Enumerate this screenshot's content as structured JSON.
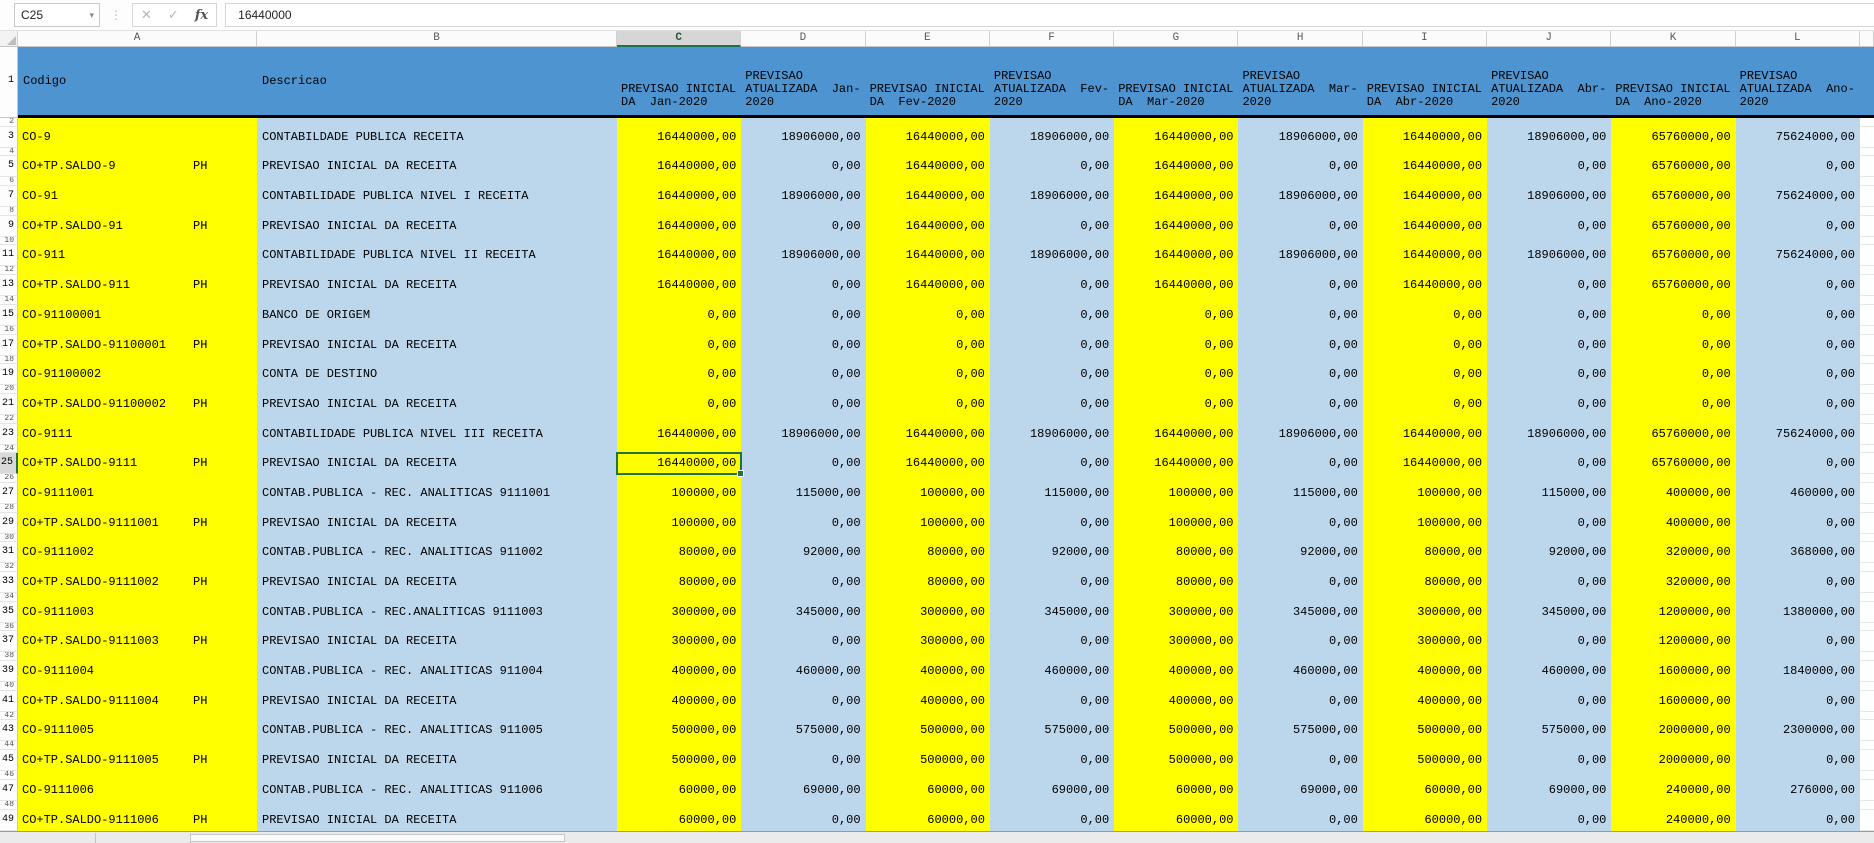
{
  "formula_bar": {
    "name_box": "C25",
    "formula": "16440000"
  },
  "icons": {
    "name_box_caret": "▾",
    "separator_dots": "⋮",
    "cancel": "✕",
    "accept": "✓",
    "function": "fx"
  },
  "colors": {
    "header_blue": "#4D94D0",
    "band_yellow": "#FFFF00",
    "band_blue": "#BCD6EC",
    "selection_green": "#1F7244"
  },
  "sheet": {
    "selected_cell": "C25",
    "selected_row": 25,
    "selected_col": "C",
    "col_letters": [
      "A",
      "B",
      "C",
      "D",
      "E",
      "F",
      "G",
      "H",
      "I",
      "J",
      "K",
      "L"
    ],
    "row1_number": "1",
    "headers": [
      "Codigo",
      "Descricao",
      "PREVISAO INICIAL\nDA  Jan-2020",
      "PREVISAO\nATUALIZADA  Jan-\n2020",
      "PREVISAO INICIAL\nDA  Fev-2020",
      "PREVISAO\nATUALIZADA  Fev-\n2020",
      "PREVISAO INICIAL\nDA  Mar-2020",
      "PREVISAO\nATUALIZADA  Mar-\n2020",
      "PREVISAO INICIAL\nDA  Abr-2020",
      "PREVISAO\nATUALIZADA  Abr-\n2020",
      "PREVISAO INICIAL\nDA  Ano-2020",
      "PREVISAO\nATUALIZADA  Ano-\n2020"
    ],
    "rows": [
      {
        "n": 2,
        "type": "spacer"
      },
      {
        "n": 3,
        "type": "data",
        "code": "CO-9",
        "ph": "",
        "desc": "CONTABILDADE PUBLICA RECEITA",
        "values": [
          "16440000,00",
          "18906000,00",
          "16440000,00",
          "18906000,00",
          "16440000,00",
          "18906000,00",
          "16440000,00",
          "18906000,00",
          "65760000,00",
          "75624000,00"
        ]
      },
      {
        "n": 4,
        "type": "spacer"
      },
      {
        "n": 5,
        "type": "data",
        "code": "CO+TP.SALDO-9",
        "ph": "PH",
        "desc": "PREVISAO INICIAL DA RECEITA",
        "values": [
          "16440000,00",
          "0,00",
          "16440000,00",
          "0,00",
          "16440000,00",
          "0,00",
          "16440000,00",
          "0,00",
          "65760000,00",
          "0,00"
        ]
      },
      {
        "n": 6,
        "type": "spacer"
      },
      {
        "n": 7,
        "type": "data",
        "code": "CO-91",
        "ph": "",
        "desc": "CONTABILIDADE PUBLICA NIVEL I RECEITA",
        "values": [
          "16440000,00",
          "18906000,00",
          "16440000,00",
          "18906000,00",
          "16440000,00",
          "18906000,00",
          "16440000,00",
          "18906000,00",
          "65760000,00",
          "75624000,00"
        ]
      },
      {
        "n": 8,
        "type": "spacer"
      },
      {
        "n": 9,
        "type": "data",
        "code": "CO+TP.SALDO-91",
        "ph": "PH",
        "desc": "PREVISAO INICIAL DA RECEITA",
        "values": [
          "16440000,00",
          "0,00",
          "16440000,00",
          "0,00",
          "16440000,00",
          "0,00",
          "16440000,00",
          "0,00",
          "65760000,00",
          "0,00"
        ]
      },
      {
        "n": 10,
        "type": "spacer"
      },
      {
        "n": 11,
        "type": "data",
        "code": "CO-911",
        "ph": "",
        "desc": "CONTABILIDADE PUBLICA NIVEL II RECEITA",
        "values": [
          "16440000,00",
          "18906000,00",
          "16440000,00",
          "18906000,00",
          "16440000,00",
          "18906000,00",
          "16440000,00",
          "18906000,00",
          "65760000,00",
          "75624000,00"
        ]
      },
      {
        "n": 12,
        "type": "spacer"
      },
      {
        "n": 13,
        "type": "data",
        "code": "CO+TP.SALDO-911",
        "ph": "PH",
        "desc": "PREVISAO INICIAL DA RECEITA",
        "values": [
          "16440000,00",
          "0,00",
          "16440000,00",
          "0,00",
          "16440000,00",
          "0,00",
          "16440000,00",
          "0,00",
          "65760000,00",
          "0,00"
        ]
      },
      {
        "n": 14,
        "type": "spacer"
      },
      {
        "n": 15,
        "type": "data",
        "code": "CO-91100001",
        "ph": "",
        "desc": "BANCO DE ORIGEM",
        "values": [
          "0,00",
          "0,00",
          "0,00",
          "0,00",
          "0,00",
          "0,00",
          "0,00",
          "0,00",
          "0,00",
          "0,00"
        ]
      },
      {
        "n": 16,
        "type": "spacer"
      },
      {
        "n": 17,
        "type": "data",
        "code": "CO+TP.SALDO-91100001",
        "ph": "PH",
        "desc": "PREVISAO INICIAL DA RECEITA",
        "values": [
          "0,00",
          "0,00",
          "0,00",
          "0,00",
          "0,00",
          "0,00",
          "0,00",
          "0,00",
          "0,00",
          "0,00"
        ]
      },
      {
        "n": 18,
        "type": "spacer"
      },
      {
        "n": 19,
        "type": "data",
        "code": "CO-91100002",
        "ph": "",
        "desc": "CONTA DE DESTINO",
        "values": [
          "0,00",
          "0,00",
          "0,00",
          "0,00",
          "0,00",
          "0,00",
          "0,00",
          "0,00",
          "0,00",
          "0,00"
        ]
      },
      {
        "n": 20,
        "type": "spacer"
      },
      {
        "n": 21,
        "type": "data",
        "code": "CO+TP.SALDO-91100002",
        "ph": "PH",
        "desc": "PREVISAO INICIAL DA RECEITA",
        "values": [
          "0,00",
          "0,00",
          "0,00",
          "0,00",
          "0,00",
          "0,00",
          "0,00",
          "0,00",
          "0,00",
          "0,00"
        ]
      },
      {
        "n": 22,
        "type": "spacer"
      },
      {
        "n": 23,
        "type": "data",
        "code": "CO-9111",
        "ph": "",
        "desc": "CONTABILIDADE PUBLICA NIVEL III RECEITA",
        "values": [
          "16440000,00",
          "18906000,00",
          "16440000,00",
          "18906000,00",
          "16440000,00",
          "18906000,00",
          "16440000,00",
          "18906000,00",
          "65760000,00",
          "75624000,00"
        ]
      },
      {
        "n": 24,
        "type": "spacer"
      },
      {
        "n": 25,
        "type": "data",
        "code": "CO+TP.SALDO-9111",
        "ph": "PH",
        "desc": "PREVISAO INICIAL DA RECEITA",
        "values": [
          "16440000,00",
          "0,00",
          "16440000,00",
          "0,00",
          "16440000,00",
          "0,00",
          "16440000,00",
          "0,00",
          "65760000,00",
          "0,00"
        ]
      },
      {
        "n": 26,
        "type": "spacer"
      },
      {
        "n": 27,
        "type": "data",
        "code": "CO-9111001",
        "ph": "",
        "desc": "CONTAB.PUBLICA - REC. ANALITICAS 9111001",
        "values": [
          "100000,00",
          "115000,00",
          "100000,00",
          "115000,00",
          "100000,00",
          "115000,00",
          "100000,00",
          "115000,00",
          "400000,00",
          "460000,00"
        ]
      },
      {
        "n": 28,
        "type": "spacer"
      },
      {
        "n": 29,
        "type": "data",
        "code": "CO+TP.SALDO-9111001",
        "ph": "PH",
        "desc": "PREVISAO INICIAL DA RECEITA",
        "values": [
          "100000,00",
          "0,00",
          "100000,00",
          "0,00",
          "100000,00",
          "0,00",
          "100000,00",
          "0,00",
          "400000,00",
          "0,00"
        ]
      },
      {
        "n": 30,
        "type": "spacer"
      },
      {
        "n": 31,
        "type": "data",
        "code": "CO-9111002",
        "ph": "",
        "desc": "CONTAB.PUBLICA - REC. ANALITICAS 911002",
        "values": [
          "80000,00",
          "92000,00",
          "80000,00",
          "92000,00",
          "80000,00",
          "92000,00",
          "80000,00",
          "92000,00",
          "320000,00",
          "368000,00"
        ]
      },
      {
        "n": 32,
        "type": "spacer"
      },
      {
        "n": 33,
        "type": "data",
        "code": "CO+TP.SALDO-9111002",
        "ph": "PH",
        "desc": "PREVISAO INICIAL DA RECEITA",
        "values": [
          "80000,00",
          "0,00",
          "80000,00",
          "0,00",
          "80000,00",
          "0,00",
          "80000,00",
          "0,00",
          "320000,00",
          "0,00"
        ]
      },
      {
        "n": 34,
        "type": "spacer"
      },
      {
        "n": 35,
        "type": "data",
        "code": "CO-9111003",
        "ph": "",
        "desc": "CONTAB.PUBLICA - REC.ANALITICAS 9111003",
        "values": [
          "300000,00",
          "345000,00",
          "300000,00",
          "345000,00",
          "300000,00",
          "345000,00",
          "300000,00",
          "345000,00",
          "1200000,00",
          "1380000,00"
        ]
      },
      {
        "n": 36,
        "type": "spacer"
      },
      {
        "n": 37,
        "type": "data",
        "code": "CO+TP.SALDO-9111003",
        "ph": "PH",
        "desc": "PREVISAO INICIAL DA RECEITA",
        "values": [
          "300000,00",
          "0,00",
          "300000,00",
          "0,00",
          "300000,00",
          "0,00",
          "300000,00",
          "0,00",
          "1200000,00",
          "0,00"
        ]
      },
      {
        "n": 38,
        "type": "spacer"
      },
      {
        "n": 39,
        "type": "data",
        "code": "CO-9111004",
        "ph": "",
        "desc": "CONTAB.PUBLICA - REC. ANALITICAS 911004",
        "values": [
          "400000,00",
          "460000,00",
          "400000,00",
          "460000,00",
          "400000,00",
          "460000,00",
          "400000,00",
          "460000,00",
          "1600000,00",
          "1840000,00"
        ]
      },
      {
        "n": 40,
        "type": "spacer"
      },
      {
        "n": 41,
        "type": "data",
        "code": "CO+TP.SALDO-9111004",
        "ph": "PH",
        "desc": "PREVISAO INICIAL DA RECEITA",
        "values": [
          "400000,00",
          "0,00",
          "400000,00",
          "0,00",
          "400000,00",
          "0,00",
          "400000,00",
          "0,00",
          "1600000,00",
          "0,00"
        ]
      },
      {
        "n": 42,
        "type": "spacer"
      },
      {
        "n": 43,
        "type": "data",
        "code": "CO-9111005",
        "ph": "",
        "desc": "CONTAB.PUBLICA - REC. ANALITICAS 911005",
        "values": [
          "500000,00",
          "575000,00",
          "500000,00",
          "575000,00",
          "500000,00",
          "575000,00",
          "500000,00",
          "575000,00",
          "2000000,00",
          "2300000,00"
        ]
      },
      {
        "n": 44,
        "type": "spacer"
      },
      {
        "n": 45,
        "type": "data",
        "code": "CO+TP.SALDO-9111005",
        "ph": "PH",
        "desc": "PREVISAO INICIAL DA RECEITA",
        "values": [
          "500000,00",
          "0,00",
          "500000,00",
          "0,00",
          "500000,00",
          "0,00",
          "500000,00",
          "0,00",
          "2000000,00",
          "0,00"
        ]
      },
      {
        "n": 46,
        "type": "spacer"
      },
      {
        "n": 47,
        "type": "data",
        "code": "CO-9111006",
        "ph": "",
        "desc": "CONTAB.PUBLICA - REC. ANALITICAS 911006",
        "values": [
          "60000,00",
          "69000,00",
          "60000,00",
          "69000,00",
          "60000,00",
          "69000,00",
          "60000,00",
          "69000,00",
          "240000,00",
          "276000,00"
        ]
      },
      {
        "n": 48,
        "type": "spacer"
      },
      {
        "n": 49,
        "type": "data",
        "code": "CO+TP.SALDO-9111006",
        "ph": "PH",
        "desc": "PREVISAO INICIAL DA RECEITA",
        "values": [
          "60000,00",
          "0,00",
          "60000,00",
          "0,00",
          "60000,00",
          "0,00",
          "60000,00",
          "0,00",
          "240000,00",
          "0,00"
        ]
      }
    ]
  }
}
